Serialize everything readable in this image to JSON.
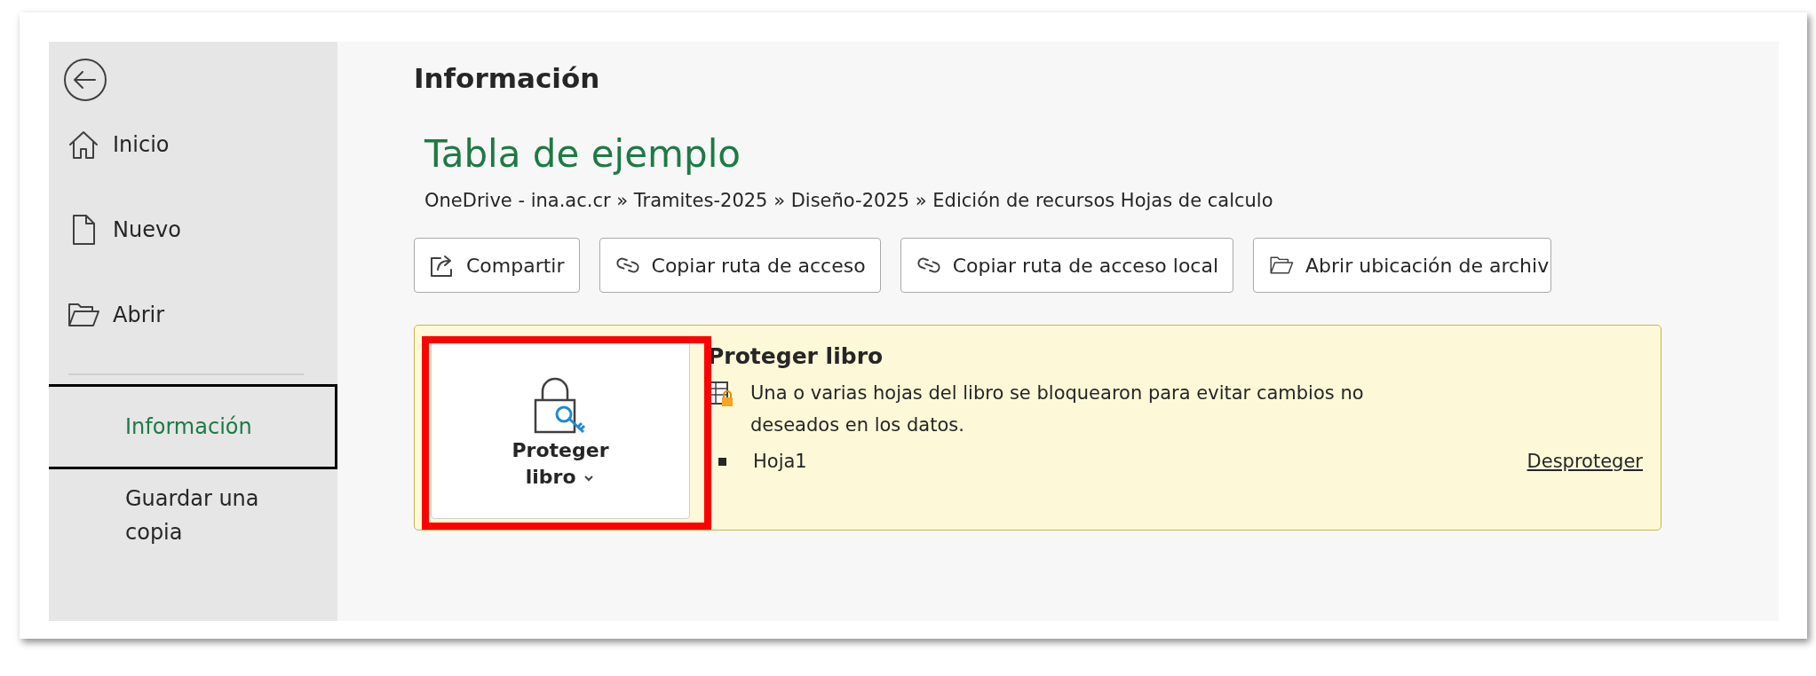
{
  "sidebar": {
    "items": [
      {
        "label": "Inicio",
        "kind": "home",
        "selected": false
      },
      {
        "label": "Nuevo",
        "kind": "new",
        "selected": false
      },
      {
        "label": "Abrir",
        "kind": "open",
        "selected": false
      },
      {
        "label": "Información",
        "kind": "plain",
        "selected": true
      },
      {
        "label": "Guardar una copia",
        "kind": "plain",
        "selected": false
      }
    ]
  },
  "page_title": "Información",
  "document": {
    "name": "Tabla de ejemplo",
    "path": "OneDrive - ina.ac.cr » Tramites-2025 » Diseño-2025 » Edición de recursos Hojas de calculo"
  },
  "actions": [
    {
      "label": "Compartir",
      "kind": "share"
    },
    {
      "label": "Copiar ruta de acceso",
      "kind": "link"
    },
    {
      "label": "Copiar ruta de acceso local",
      "kind": "link"
    },
    {
      "label": "Abrir ubicación de archiv",
      "kind": "folder"
    }
  ],
  "protection": {
    "button_label": "Proteger libro",
    "highlighted": true,
    "title": "Proteger libro",
    "description": "Una o varias hojas del libro se bloquearon para evitar cambios no deseados en los datos.",
    "sheets": [
      {
        "name": "Hoja1"
      }
    ],
    "unprotect_link": "Desproteger"
  }
}
